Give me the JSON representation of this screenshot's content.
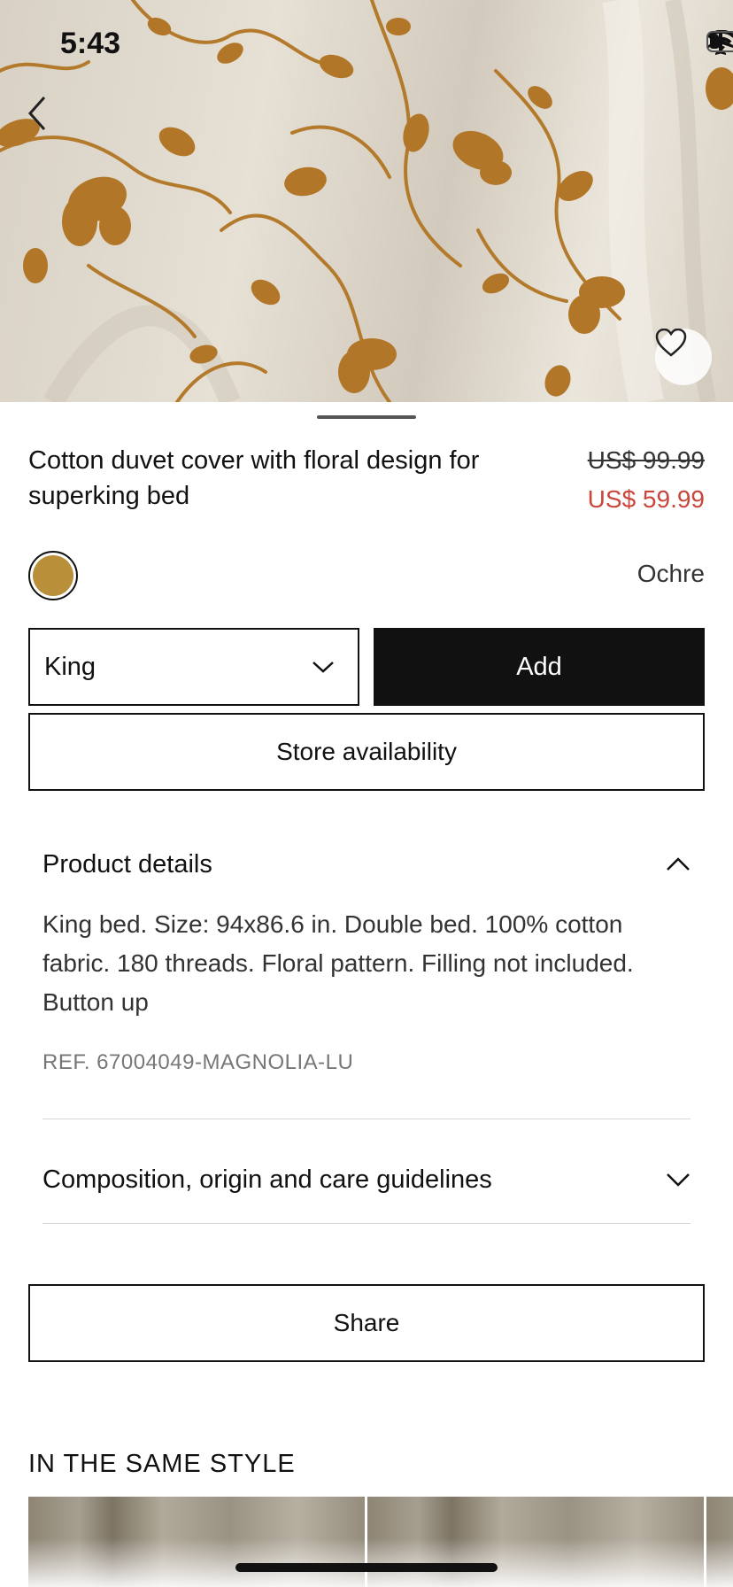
{
  "status_bar": {
    "time": "5:43"
  },
  "hero": {
    "image_description_icon": "floral-duvet-photo"
  },
  "product": {
    "title": "Cotton duvet cover with floral design for superking bed",
    "price_original": "US$ 99.99",
    "price_sale": "US$ 59.99",
    "sale_color": "#c8463c",
    "color_name": "Ochre",
    "color_swatch": "#b98f3a"
  },
  "actions": {
    "size_selected": "King",
    "add_label": "Add",
    "store_label": "Store availability",
    "share_label": "Share"
  },
  "details": {
    "heading": "Product details",
    "text": "King bed. Size: 94x86.6 in. Double bed. 100% cotton fabric. 180 threads. Floral pattern. Filling not included. Button up",
    "ref": "REF. 67004049-MAGNOLIA-LU"
  },
  "composition": {
    "heading": "Composition, origin and care guidelines"
  },
  "related": {
    "heading": "IN THE SAME STYLE"
  }
}
